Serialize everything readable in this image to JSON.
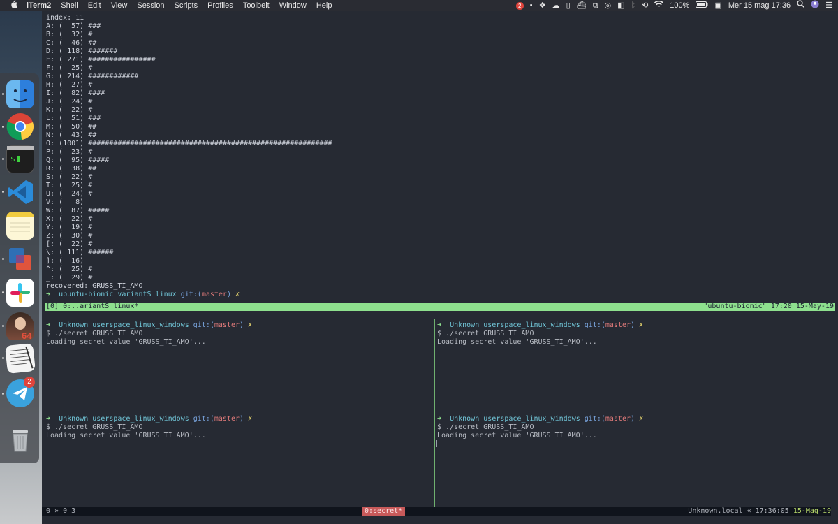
{
  "menubar": {
    "apple": "",
    "items": [
      "iTerm2",
      "Shell",
      "Edit",
      "View",
      "Session",
      "Scripts",
      "Profiles",
      "Toolbelt",
      "Window",
      "Help"
    ],
    "battery": "100%",
    "datetime": "Mer 15 mag  17:36",
    "notification_count": "2"
  },
  "dock": {
    "apps": [
      {
        "name": "finder-icon",
        "color": "#3d8be6"
      },
      {
        "name": "chrome-icon",
        "color": "#e3e3e3"
      },
      {
        "name": "terminal-icon",
        "color": "#2c2c2c"
      },
      {
        "name": "vscode-icon",
        "color": "#2677c9"
      },
      {
        "name": "notes-icon",
        "color": "#f4d860"
      },
      {
        "name": "virtualbox-icon",
        "color": "#2f6fb5"
      },
      {
        "name": "slack-icon",
        "color": "#ffffff"
      },
      {
        "name": "ida-icon",
        "color": "#c45a4a"
      },
      {
        "name": "textedit-icon",
        "color": "#e8e8e8"
      },
      {
        "name": "telegram-icon",
        "color": "#3aa2dd"
      },
      {
        "name": "trash-icon",
        "color": "#9ea2a6"
      }
    ],
    "telegram_badge": "2"
  },
  "top_pane": {
    "index_line": "index: 11",
    "rows": [
      "A: (  57) ###",
      "B: (  32) #",
      "C: (  46) ##",
      "D: ( 118) #######",
      "E: ( 271) ################",
      "F: (  25) #",
      "G: ( 214) ############",
      "H: (  27) #",
      "I: (  82) ####",
      "J: (  24) #",
      "K: (  22) #",
      "L: (  51) ###",
      "M: (  50) ##",
      "N: (  43) ##",
      "O: (1001) ##########################################################",
      "P: (  23) #",
      "Q: (  95) #####",
      "R: (  38) ##",
      "S: (  22) #",
      "T: (  25) #",
      "U: (  24) #",
      "V: (   8)",
      "W: (  87) #####",
      "X: (  22) #",
      "Y: (  19) #",
      "Z: (  30) #",
      "[: (  22) #",
      "\\: ( 111) ######",
      "]: (  16)",
      "^: (  25) #",
      "_: (  29) #"
    ],
    "recovered": "recovered: GRUSS_TI_AMO",
    "prompt": {
      "arrow": "➜",
      "host": "ubuntu-bionic",
      "dir": "variantS_linux",
      "git_label": "git:(",
      "branch": "master",
      "git_close": ")",
      "dirty": "✗"
    }
  },
  "tmux_top": {
    "left": "[0] 0:..ariantS_linux*",
    "right": "\"ubuntu-bionic\" 17:20 15-May-19"
  },
  "panes": [
    {
      "arrow": "➜",
      "host": "Unknown",
      "dir": "userspace_linux_windows",
      "git_label": "git:(",
      "branch": "master",
      "git_close": ")",
      "dirty": "✗",
      "cmd": "$ ./secret GRUSS_TI_AMO",
      "out": "Loading secret value 'GRUSS_TI_AMO'..."
    },
    {
      "arrow": "➜",
      "host": "Unknown",
      "dir": "userspace_linux_windows",
      "git_label": "git:(",
      "branch": "master",
      "git_close": ")",
      "dirty": "✗",
      "cmd": "$ ./secret GRUSS_TI_AMO",
      "out": "Loading secret value 'GRUSS_TI_AMO'..."
    },
    {
      "arrow": "➜",
      "host": "Unknown",
      "dir": "userspace_linux_windows",
      "git_label": "git:(",
      "branch": "master",
      "git_close": ")",
      "dirty": "✗",
      "cmd": "$ ./secret GRUSS_TI_AMO",
      "out": "Loading secret value 'GRUSS_TI_AMO'..."
    },
    {
      "arrow": "➜",
      "host": "Unknown",
      "dir": "userspace_linux_windows",
      "git_label": "git:(",
      "branch": "master",
      "git_close": ")",
      "dirty": "✗",
      "cmd": "$ ./secret GRUSS_TI_AMO",
      "out": "Loading secret value 'GRUSS_TI_AMO'..."
    }
  ],
  "bottom_status": {
    "left": "0 » 0 3",
    "center": "0:secret*",
    "right_host": "Unknown.local « 17:36:05 ",
    "right_date": "15-Mag-19"
  }
}
